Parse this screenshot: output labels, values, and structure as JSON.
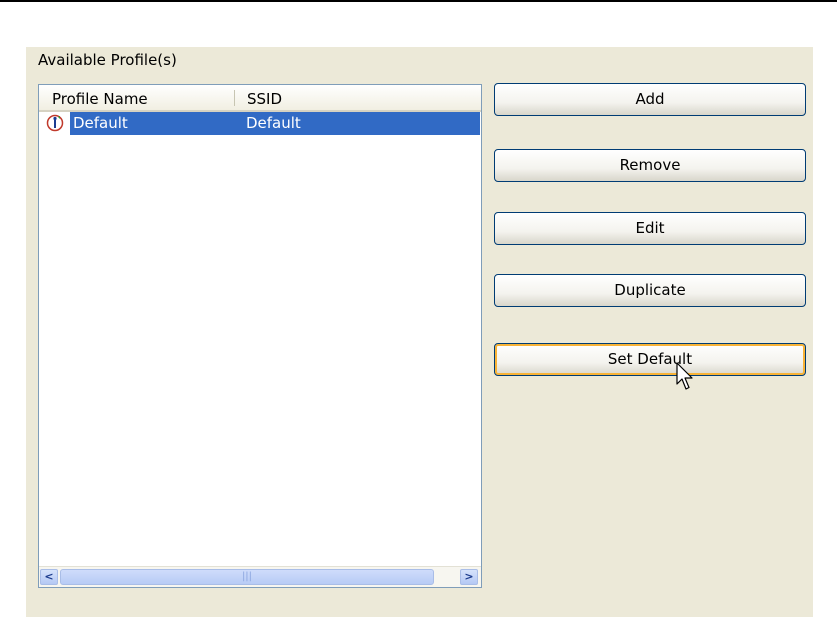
{
  "group": {
    "label": "Available Profile(s)"
  },
  "list": {
    "columns": [
      "Profile Name",
      "SSID"
    ],
    "rows": [
      {
        "profile_name": "Default",
        "ssid": "Default",
        "selected": true,
        "icon": "default-profile-icon"
      }
    ]
  },
  "scrollbar": {
    "left_arrow": "<",
    "right_arrow": ">",
    "grip": "|||"
  },
  "buttons": {
    "add": "Add",
    "remove": "Remove",
    "edit": "Edit",
    "duplicate": "Duplicate",
    "set_default": "Set Default"
  },
  "colors": {
    "selection": "#316ac5",
    "panel": "#ece9d8",
    "hover_border": "#f8b337"
  }
}
